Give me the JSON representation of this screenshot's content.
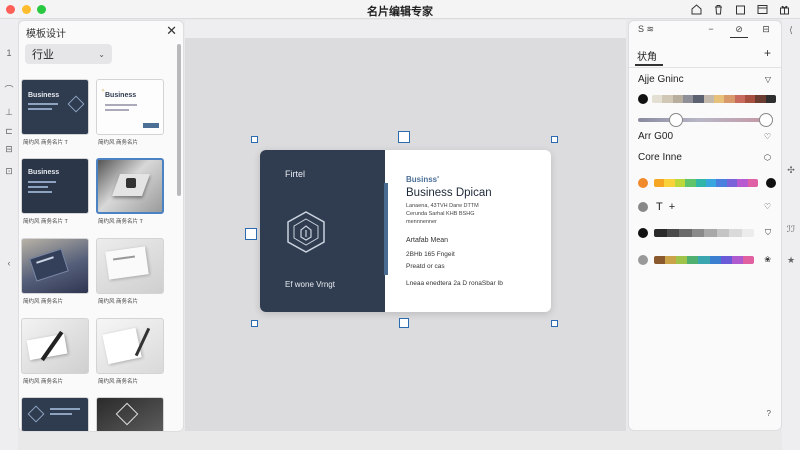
{
  "app": {
    "title": "名片编辑专家"
  },
  "left_rail": {
    "items": [
      "1",
      "⌒",
      "⊥",
      "⊏",
      "⊟",
      "⊡",
      "‹"
    ]
  },
  "templates": {
    "header": "模板设计",
    "close": "✕",
    "category": "行业",
    "items": [
      {
        "label": "Business",
        "caption": "简约风 商务名片   T"
      },
      {
        "label": "Business",
        "caption": "简约风 商务名片"
      },
      {
        "label": "Business",
        "caption": "简约风 商务名片 T",
        "caption2": "   T  商务名片"
      },
      {
        "label": "",
        "caption": "简约风 商务名片  T"
      },
      {
        "label": "",
        "caption": "简约风 商务名片"
      },
      {
        "label": "",
        "caption": "简约风 商务名片"
      },
      {
        "label": "",
        "caption": "简约风 商务名片"
      },
      {
        "label": "",
        "caption": "简约风 商务名片"
      },
      {
        "label": "",
        "caption": ""
      },
      {
        "label": "",
        "caption": ""
      }
    ]
  },
  "card": {
    "brand": "Firtel",
    "tagline": "Ef wone Vrngt",
    "kicker": "Businss'",
    "name": "Business Dpican",
    "lines": [
      "Lanaena, 43TVH Darw DTTM",
      "Cerunda Sarhal KHB BSHG",
      "mennnenner"
    ],
    "subtitle": "Artafab Mean",
    "detail1": "2BHb 165 Fngeit",
    "detail2": "Preatd or cas",
    "footer": "Lneaa enedtera 2a D ronaSbar Ib"
  },
  "properties": {
    "tabs": [
      "S ≋",
      "−",
      "⊘",
      "⊟"
    ],
    "section": "状角",
    "plus": "+",
    "rows": [
      {
        "label": "Ajje Gninc",
        "icon": "▽"
      },
      {
        "label": "Arr G00",
        "icon": "♡"
      },
      {
        "label": "Core Inne",
        "icon": "⬡"
      }
    ],
    "text_tools": [
      "T",
      "+"
    ],
    "help": "?"
  },
  "right_rail": {
    "items": [
      "✣",
      "ℐℐ",
      "★"
    ]
  },
  "colors": {
    "card_dark": "#303c4f",
    "accent": "#4c6f96",
    "selection": "#2b6cb0"
  }
}
